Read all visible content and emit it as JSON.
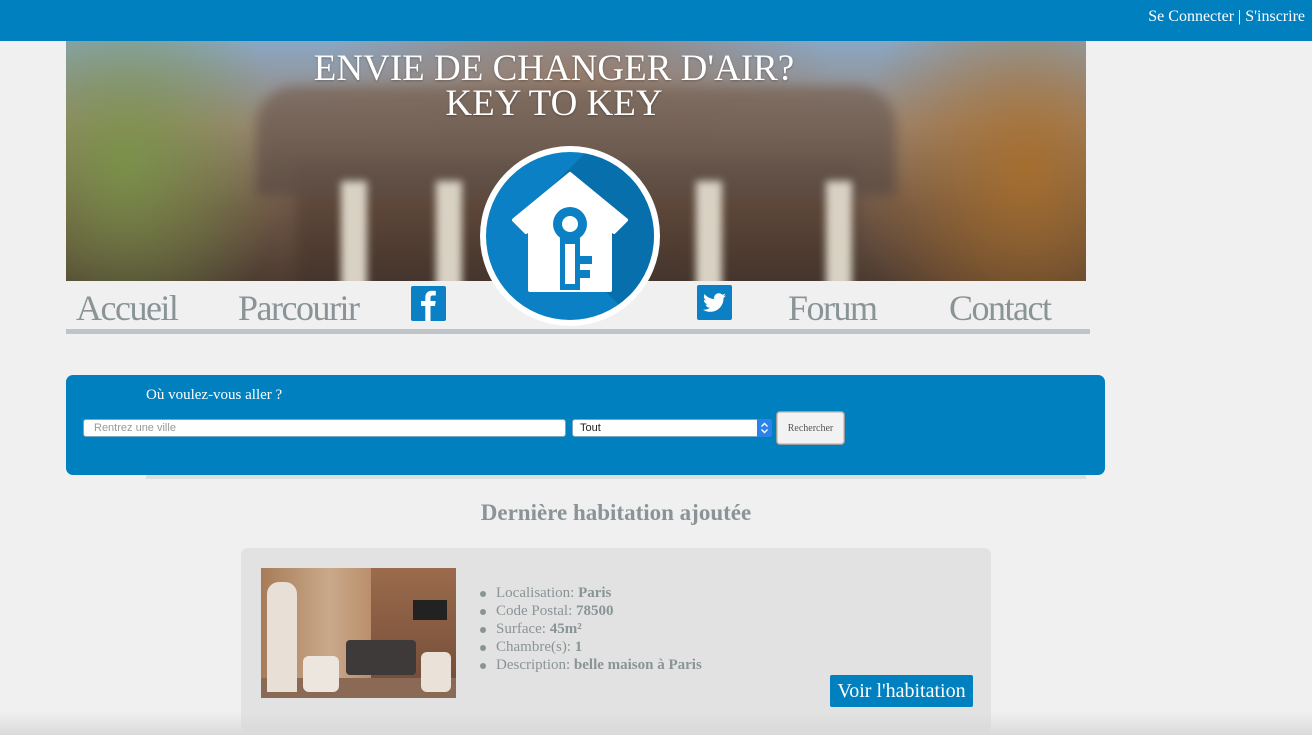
{
  "header": {
    "login": "Se Connecter",
    "separator": "|",
    "signup": "S'inscrire"
  },
  "hero": {
    "title_line1": "ENVIE DE CHANGER D'AIR?",
    "title_line2": "KEY TO KEY"
  },
  "nav": {
    "home": "Accueil",
    "browse": "Parcourir",
    "facebook_icon": "facebook-icon",
    "twitter_icon": "twitter-icon",
    "forum": "Forum",
    "contact": "Contact"
  },
  "search": {
    "label": "Où voulez-vous aller ?",
    "city_placeholder": "Rentrez une ville",
    "type_selected": "Tout",
    "button": "Rechercher"
  },
  "latest": {
    "title": "Dernière habitation ajoutée",
    "location_label": "Localisation:",
    "location": "Paris",
    "postal_label": "Code Postal:",
    "postal": "78500",
    "surface_label": "Surface:",
    "surface": "45m²",
    "rooms_label": "Chambre(s):",
    "rooms": "1",
    "description_label": "Description:",
    "description": "belle maison à Paris",
    "button": "Voir l'habitation"
  },
  "colors": {
    "primary": "#0080bf",
    "background": "#f0f0f0",
    "nav_text": "#8a9497"
  }
}
